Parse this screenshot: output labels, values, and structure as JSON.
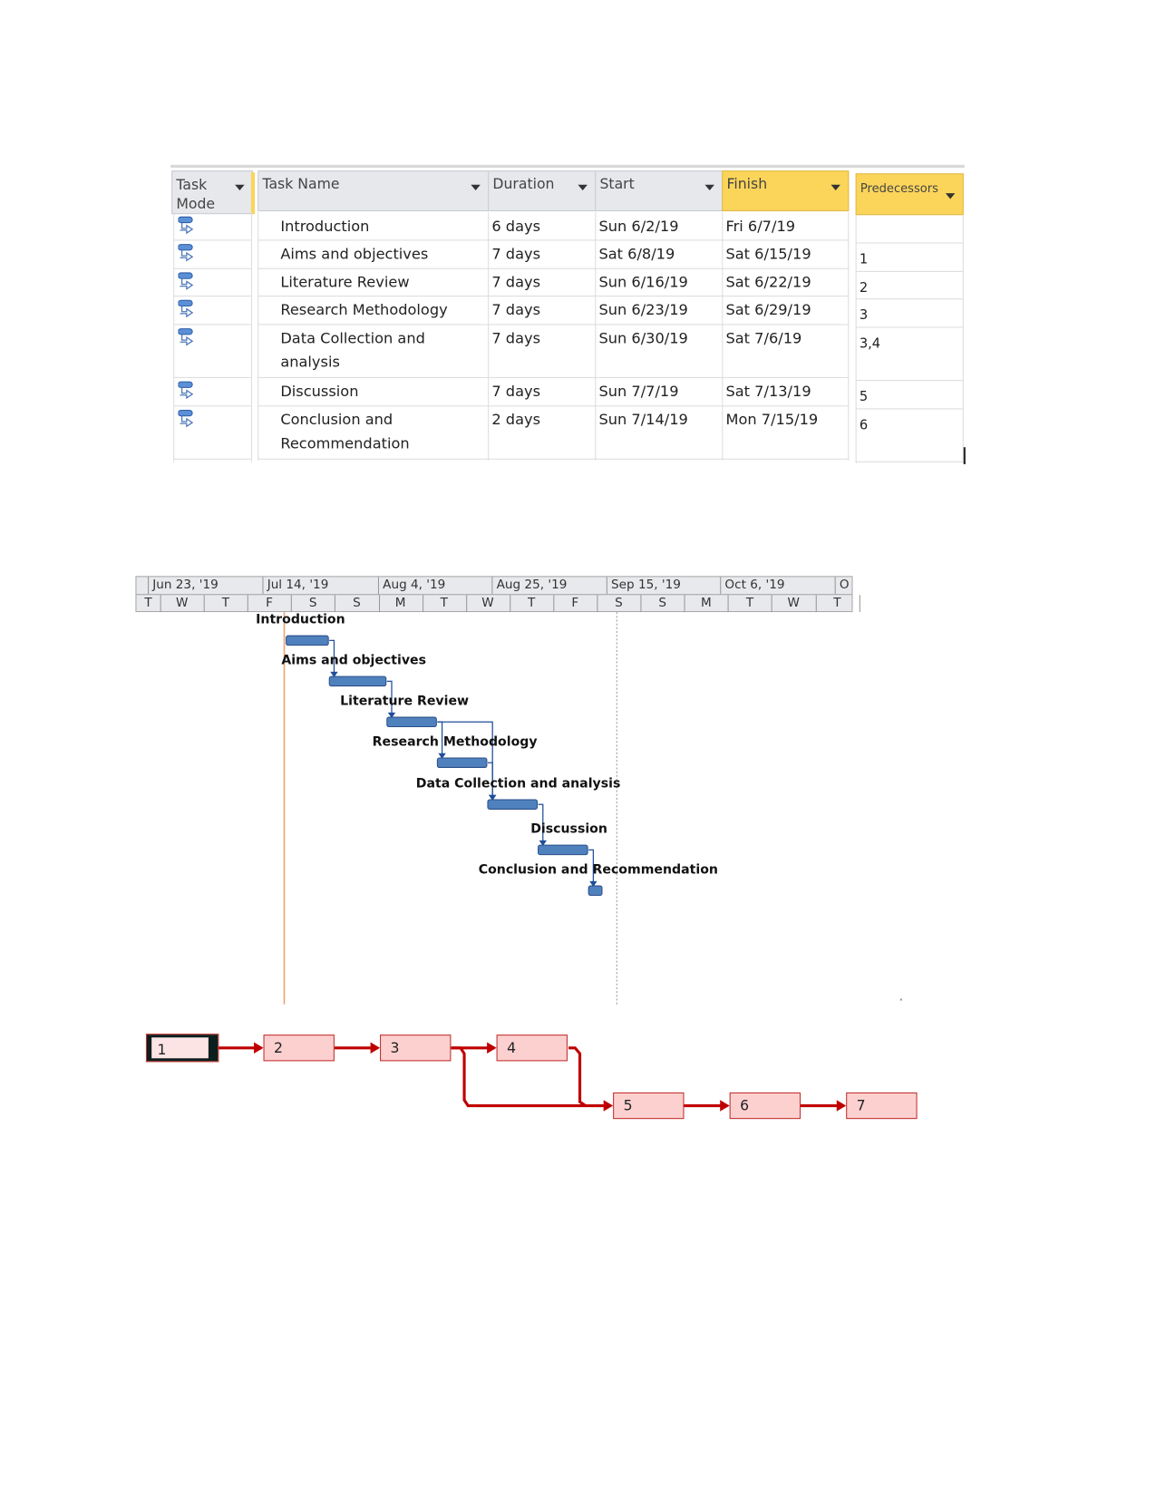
{
  "table": {
    "columns": {
      "task_mode": "Task Mode",
      "task_name": "Task Name",
      "duration": "Duration",
      "start": "Start",
      "finish": "Finish",
      "predecessors": "Predecessors"
    },
    "rows": [
      {
        "id": 1,
        "name": "Introduction",
        "duration": "6 days",
        "start": "Sun 6/2/19",
        "finish": "Fri 6/7/19",
        "pred": ""
      },
      {
        "id": 2,
        "name": " Aims and objectives",
        "duration": "7 days",
        "start": "Sat 6/8/19",
        "finish": "Sat 6/15/19",
        "pred": "1"
      },
      {
        "id": 3,
        "name": "Literature Review",
        "duration": "7 days",
        "start": "Sun 6/16/19",
        "finish": "Sat 6/22/19",
        "pred": "2"
      },
      {
        "id": 4,
        "name": "Research Methodology",
        "duration": "7 days",
        "start": "Sun 6/23/19",
        "finish": "Sat 6/29/19",
        "pred": "3"
      },
      {
        "id": 5,
        "name": "Data Collection and analysis",
        "duration": "7 days",
        "start": "Sun 6/30/19",
        "finish": "Sat 7/6/19",
        "pred": "3,4"
      },
      {
        "id": 6,
        "name": "Discussion",
        "duration": "7 days",
        "start": "Sun 7/7/19",
        "finish": "Sat 7/13/19",
        "pred": "5"
      },
      {
        "id": 7,
        "name": "Conclusion and Recommendation",
        "duration": "2 days",
        "start": "Sun 7/14/19",
        "finish": "Mon 7/15/19",
        "pred": "6"
      }
    ],
    "task_mode_icon": "auto-scheduled-task-icon"
  },
  "gantt": {
    "major_ticks": [
      "Jun 23, '19",
      "Jul 14, '19",
      "Aug 4, '19",
      "Aug 25, '19",
      "Sep 15, '19",
      "Oct 6, '19",
      "O"
    ],
    "minor_ticks": [
      "T",
      "W",
      "T",
      "F",
      "S",
      "S",
      "M",
      "T",
      "W",
      "T",
      "F",
      "S",
      "S",
      "M",
      "T",
      "W",
      "T"
    ],
    "bars": [
      {
        "label": "Introduction",
        "start": "2019-06-02",
        "end": "2019-06-08",
        "pred": []
      },
      {
        "label": "Aims and objectives",
        "start": "2019-06-08",
        "end": "2019-06-16",
        "pred": [
          0
        ]
      },
      {
        "label": "Literature Review",
        "start": "2019-06-16",
        "end": "2019-06-23",
        "pred": [
          1
        ]
      },
      {
        "label": "Research Methodology",
        "start": "2019-06-23",
        "end": "2019-06-30",
        "pred": [
          2
        ]
      },
      {
        "label": "Data Collection and analysis",
        "start": "2019-06-30",
        "end": "2019-07-07",
        "pred": [
          2,
          3
        ]
      },
      {
        "label": "Discussion",
        "start": "2019-07-07",
        "end": "2019-07-14",
        "pred": [
          4
        ]
      },
      {
        "label": "Conclusion and Recommendation",
        "start": "2019-07-14",
        "end": "2019-07-16",
        "pred": [
          5
        ]
      }
    ],
    "colors": {
      "bar": "#4f81bd",
      "today_line": "#f0a070",
      "link": "#1f4e9a"
    }
  },
  "network": {
    "nodes": [
      "1",
      "2",
      "3",
      "4",
      "5",
      "6",
      "7"
    ],
    "selected": "1",
    "colors": {
      "box": "#fdd0d0",
      "border": "#c0302c",
      "arrow": "#c00000"
    }
  }
}
